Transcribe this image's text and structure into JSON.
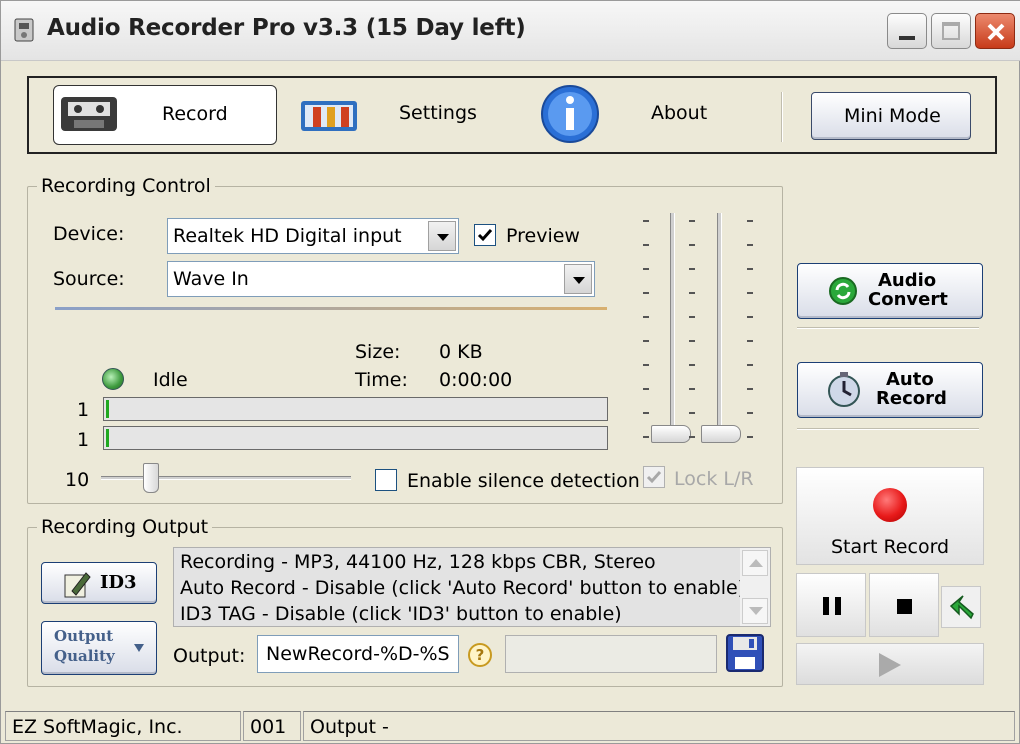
{
  "window": {
    "title": "Audio Recorder Pro v3.3 (15 Day left)"
  },
  "toolbar": {
    "record_label": "Record",
    "settings_label": "Settings",
    "about_label": "About",
    "mini_mode_label": "Mini Mode"
  },
  "recording_control": {
    "legend": "Recording Control",
    "device_label": "Device:",
    "device_value": "Realtek HD Digital input",
    "preview_label": "Preview",
    "preview_checked": true,
    "source_label": "Source:",
    "source_value": "Wave In",
    "size_label": "Size:",
    "size_value": "0 KB",
    "time_label": "Time:",
    "time_value": "0:00:00",
    "state": "Idle",
    "channel1_label": "1",
    "channel2_label": "1",
    "slider_value": "10",
    "silence_label": "Enable silence detection",
    "lock_label": "Lock L/R"
  },
  "side": {
    "audio_convert_label_1": "Audio",
    "audio_convert_label_2": "Convert",
    "auto_record_label_1": "Auto",
    "auto_record_label_2": "Record",
    "start_record_label": "Start Record"
  },
  "recording_output": {
    "legend": "Recording Output",
    "id3_label": "ID3",
    "quality_label_1": "Output",
    "quality_label_2": "Quality",
    "lines": [
      "Recording - MP3, 44100 Hz, 128 kbps CBR, Stereo",
      "Auto Record - Disable (click 'Auto Record' button to enable)",
      "ID3 TAG - Disable (click 'ID3' button to enable)"
    ],
    "output_label": "Output:",
    "output_value": "NewRecord-%D-%S",
    "help_glyph": "?"
  },
  "statusbar": {
    "company": "EZ SoftMagic, Inc.",
    "count": "001",
    "output": "Output -"
  },
  "colors": {
    "accent_red": "#e81a1a",
    "meter_green": "#21a821",
    "border_blue": "#1c3f75"
  }
}
